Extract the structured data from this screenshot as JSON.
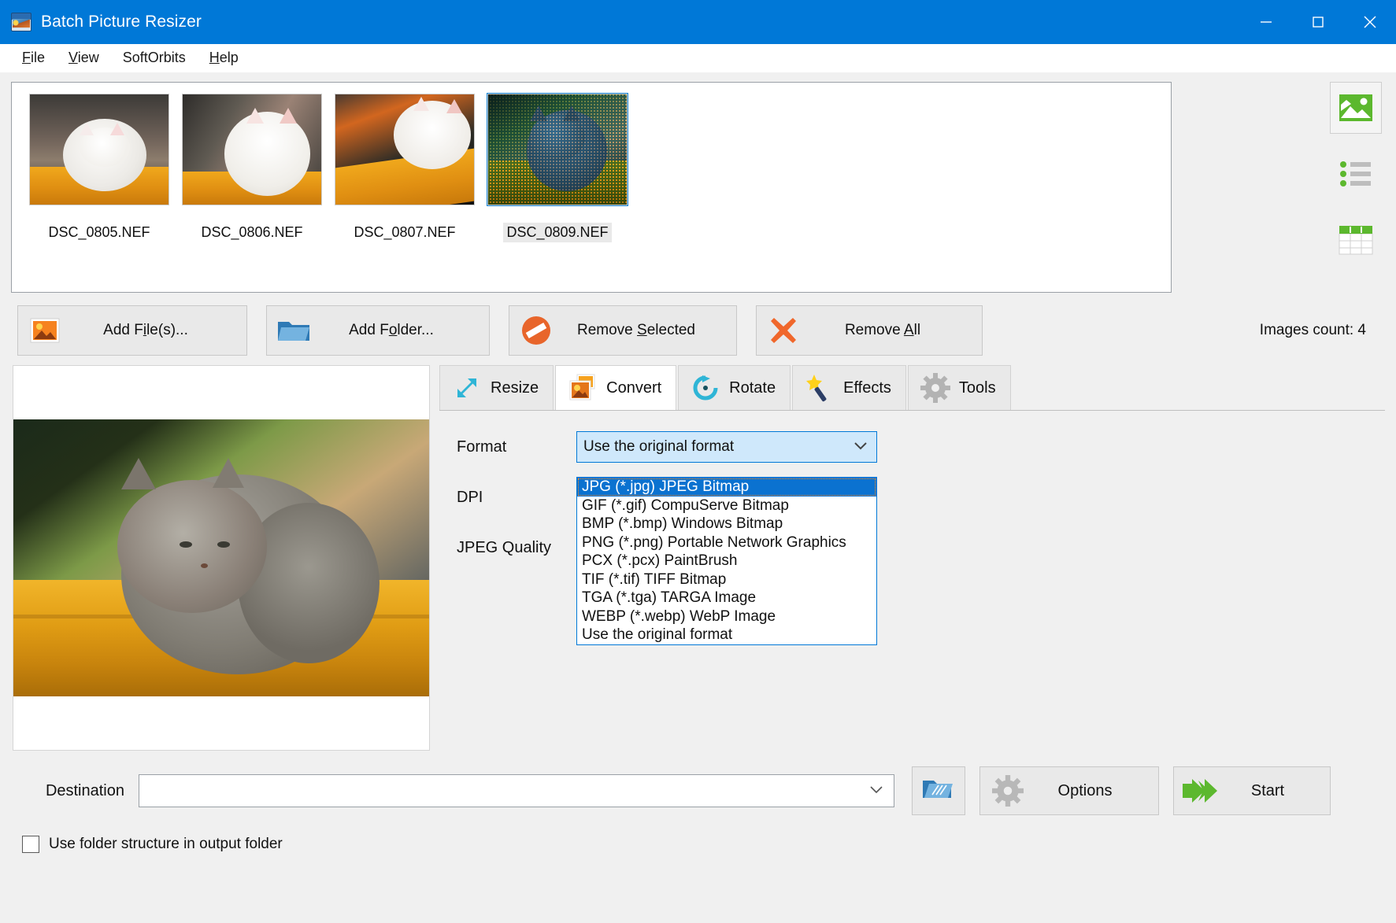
{
  "window": {
    "title": "Batch Picture Resizer",
    "app_icon": "picture-resizer-icon",
    "controls": {
      "minimize": "minimize",
      "maximize": "maximize",
      "close": "close"
    }
  },
  "menu": {
    "items": [
      {
        "label": "File",
        "mnemonic": "F"
      },
      {
        "label": "View",
        "mnemonic": "V"
      },
      {
        "label": "SoftOrbits",
        "mnemonic": ""
      },
      {
        "label": "Help",
        "mnemonic": "H"
      }
    ]
  },
  "filmstrip": {
    "items": [
      {
        "name": "DSC_0805.NEF",
        "selected": false
      },
      {
        "name": "DSC_0806.NEF",
        "selected": false
      },
      {
        "name": "DSC_0807.NEF",
        "selected": false
      },
      {
        "name": "DSC_0809.NEF",
        "selected": true
      }
    ]
  },
  "view_modes": [
    {
      "name": "thumbnail-view",
      "icon": "image-icon",
      "active": true
    },
    {
      "name": "list-view",
      "icon": "list-icon",
      "active": false
    },
    {
      "name": "details-view",
      "icon": "table-icon",
      "active": false
    }
  ],
  "actions": {
    "add_files": {
      "label": "Add File(s)...",
      "mnemonic": "i",
      "icon": "picture-icon"
    },
    "add_folder": {
      "label": "Add Folder...",
      "mnemonic": "o",
      "icon": "folder-icon"
    },
    "remove_selected": {
      "label": "Remove Selected",
      "mnemonic": "S",
      "icon": "no-entry-icon"
    },
    "remove_all": {
      "label": "Remove All",
      "mnemonic": "A",
      "icon": "cross-icon"
    },
    "images_count": "Images count: 4"
  },
  "tabs": [
    {
      "label": "Resize",
      "icon": "resize-arrow-icon",
      "active": false
    },
    {
      "label": "Convert",
      "icon": "convert-images-icon",
      "active": true
    },
    {
      "label": "Rotate",
      "icon": "rotate-icon",
      "active": false
    },
    {
      "label": "Effects",
      "icon": "magic-wand-icon",
      "active": false
    },
    {
      "label": "Tools",
      "icon": "gear-icon",
      "active": false
    }
  ],
  "convert_panel": {
    "format_label": "Format",
    "format_value": "Use the original format",
    "dpi_label": "DPI",
    "jpeg_quality_label": "JPEG Quality",
    "format_options": [
      {
        "label": "JPG (*.jpg) JPEG Bitmap",
        "selected": true
      },
      {
        "label": "GIF (*.gif) CompuServe Bitmap",
        "selected": false
      },
      {
        "label": "BMP (*.bmp) Windows Bitmap",
        "selected": false
      },
      {
        "label": "PNG (*.png) Portable Network Graphics",
        "selected": false
      },
      {
        "label": "PCX (*.pcx) PaintBrush",
        "selected": false
      },
      {
        "label": "TIF (*.tif) TIFF Bitmap",
        "selected": false
      },
      {
        "label": "TGA (*.tga) TARGA Image",
        "selected": false
      },
      {
        "label": "WEBP (*.webp) WebP Image",
        "selected": false
      },
      {
        "label": "Use the original format",
        "selected": false
      }
    ]
  },
  "destination": {
    "label": "Destination",
    "value": "",
    "placeholder": "",
    "browse_icon": "open-folder-icon"
  },
  "footer": {
    "options_label": "Options",
    "options_icon": "gear-icon",
    "start_label": "Start",
    "start_icon": "green-arrow-icon",
    "use_folder_structure_label": "Use folder structure in output folder",
    "use_folder_structure_checked": false
  },
  "colors": {
    "titlebar": "#0078d7",
    "accent": "#0b72d0",
    "combo_fill": "#cfe8fb",
    "window_bg": "#f0f0f0",
    "start_green": "#5cb82e",
    "remove_orange": "#f0672b",
    "focus_orange": "#ff8c1a"
  }
}
